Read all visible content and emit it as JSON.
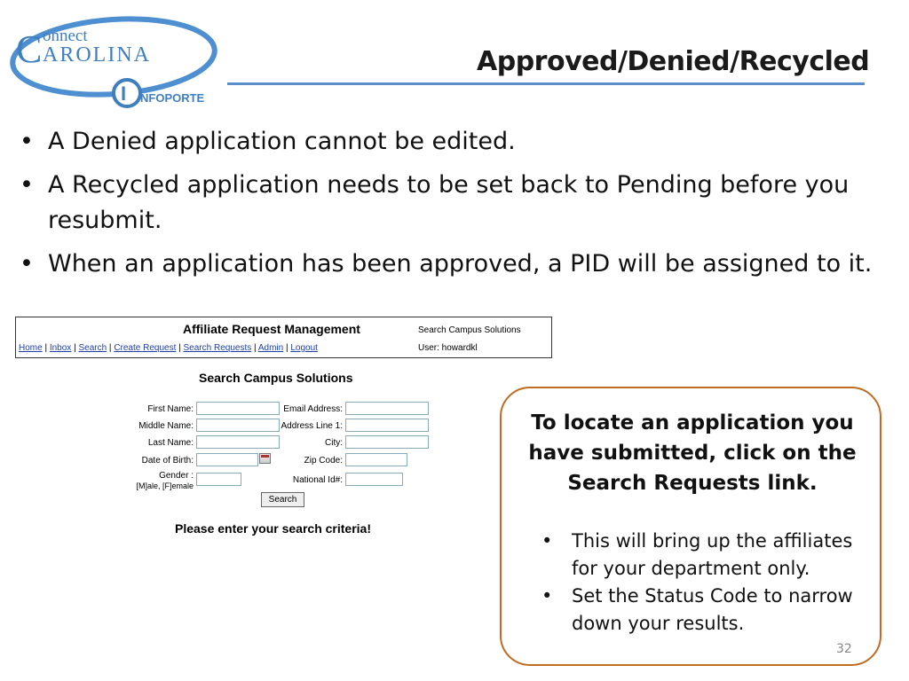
{
  "logo": {
    "line1": "onnect",
    "line2": "AROLINA",
    "initial_c": "C",
    "initial_i": "I",
    "infoporte": "NFOPORTE"
  },
  "slide": {
    "title": "Approved/Denied/Recycled",
    "page_number": "32"
  },
  "bullets": [
    "A Denied application cannot be edited.",
    "A Recycled application needs to be set back to Pending before you resubmit.",
    "When an application has been approved, a PID will be assigned to it."
  ],
  "screenshot": {
    "heading": "Affiliate Request Management",
    "search_link": "Search Campus Solutions",
    "user": "User: howardkl",
    "nav": [
      "Home",
      "Inbox",
      "Search",
      "Create Request",
      "Search Requests",
      "Admin",
      "Logout"
    ],
    "form_title": "Search Campus Solutions",
    "fields": {
      "first_name": "First Name:",
      "middle_name": "Middle Name:",
      "last_name": "Last Name:",
      "dob": "Date of Birth:",
      "gender": "Gender :",
      "gender_hint": "[M]ale, [F]emale",
      "email": "Email Address:",
      "address": "Address Line 1:",
      "city": "City:",
      "zip": "Zip Code:",
      "national_id": "National Id#:"
    },
    "search_button": "Search",
    "prompt": "Please enter your search criteria!"
  },
  "callout": {
    "heading": "To locate an application you have submitted, click on the Search Requests link.",
    "items": [
      "This will bring up the affiliates for your department only.",
      "Set the Status Code to narrow down your results."
    ]
  },
  "colors": {
    "rule": "#5b8ec9",
    "callout_border": "#c06b22",
    "logo_blue": "#3f7fc0"
  }
}
